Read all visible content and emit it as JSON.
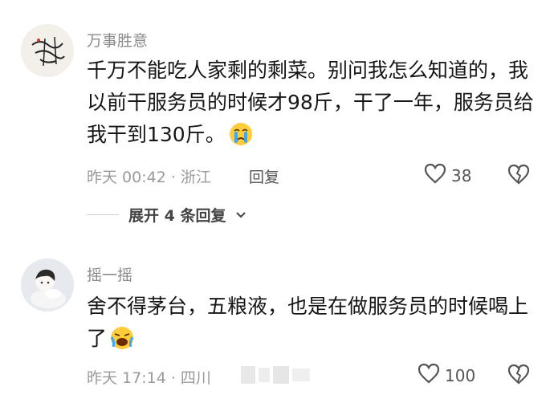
{
  "comments": [
    {
      "username": "万事胜意",
      "text": "千万不能吃人家剩的剩菜。别问我怎么知道的，我以前干服务员的时候才98斤，干了一年，服务员给我干到130斤。",
      "emoji": "crying-face",
      "meta": "昨天 00:42 · 浙江",
      "reply_label": "回复",
      "likes": "38",
      "expand_label": "展开 4 条回复"
    },
    {
      "username": "摇一摇",
      "text": "舍不得茅台，五粮液，也是在做服务员的时候喝上了",
      "emoji": "loudly-crying-face",
      "meta": "昨天 17:14 · 四川",
      "likes": "100"
    }
  ],
  "icons": {
    "like": "heart-outline-icon",
    "dislike": "broken-heart-icon",
    "expand": "chevron-down-icon"
  },
  "colors": {
    "username": "#8a8a8a",
    "text": "#161616",
    "meta": "#9a9a9a"
  }
}
